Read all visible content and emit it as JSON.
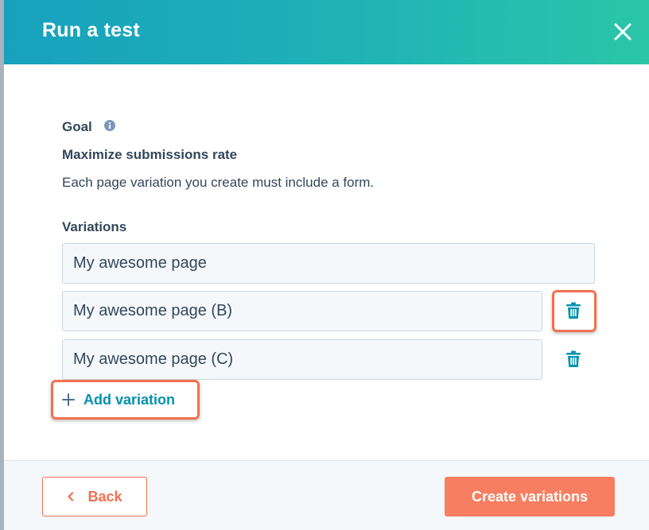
{
  "modal": {
    "title": "Run a test",
    "close_icon": "close-icon"
  },
  "goal": {
    "label": "Goal",
    "info_icon": "info-icon",
    "value": "Maximize submissions rate",
    "description": "Each page variation you create must include a form."
  },
  "variations": {
    "label": "Variations",
    "items": [
      {
        "value": "My awesome page",
        "deletable": false
      },
      {
        "value": "My awesome page (B)",
        "deletable": true
      },
      {
        "value": "My awesome page (C)",
        "deletable": true
      }
    ],
    "add_label": "Add variation",
    "add_icon": "plus-icon",
    "delete_icon": "trash-icon"
  },
  "footer": {
    "back_label": "Back",
    "back_icon": "chevron-left-icon",
    "create_label": "Create variations"
  },
  "colors": {
    "header_start": "#17a1bd",
    "header_end": "#2ac6a8",
    "accent_orange": "#f2704f",
    "primary_button": "#f87e61",
    "link_teal": "#0091ae",
    "text": "#33475b"
  }
}
